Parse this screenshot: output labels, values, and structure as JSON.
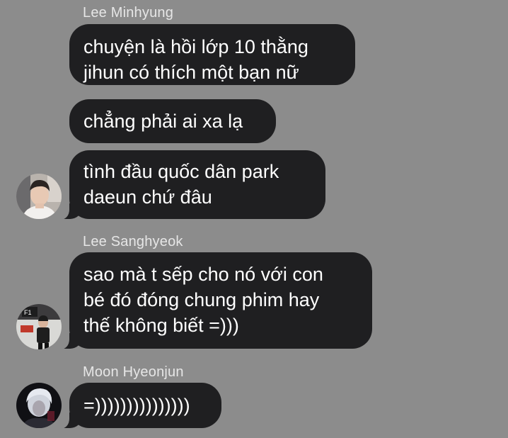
{
  "messages": [
    {
      "sender": "Lee Minhyung",
      "bubbles": [
        {
          "lines": [
            "chuyện là hồi lớp 10 thằng",
            "jihun có thích một bạn nữ"
          ]
        },
        {
          "lines": [
            "chẳng phải ai xa lạ"
          ]
        },
        {
          "lines": [
            "tình đầu quốc dân park",
            "daeun chứ đâu"
          ]
        }
      ]
    },
    {
      "sender": "Lee Sanghyeok",
      "bubbles": [
        {
          "lines": [
            "sao mà t sếp cho nó với con",
            "bé đó đóng chung phim hay",
            "thế không biết =)))"
          ]
        }
      ]
    },
    {
      "sender": "Moon Hyeonjun",
      "bubbles": [
        {
          "lines": [
            "=)))))))))))))))"
          ]
        }
      ]
    }
  ],
  "avatars": [
    {
      "icon": "profile-photo-lee-minhyung"
    },
    {
      "icon": "profile-photo-lee-sanghyeok"
    },
    {
      "icon": "profile-photo-moon-hyeonjun"
    }
  ],
  "colors": {
    "background": "#8c8c8c",
    "bubble": "#1f1f21",
    "bubble_text": "#ffffff",
    "sender_name": "#e6e6e6"
  }
}
